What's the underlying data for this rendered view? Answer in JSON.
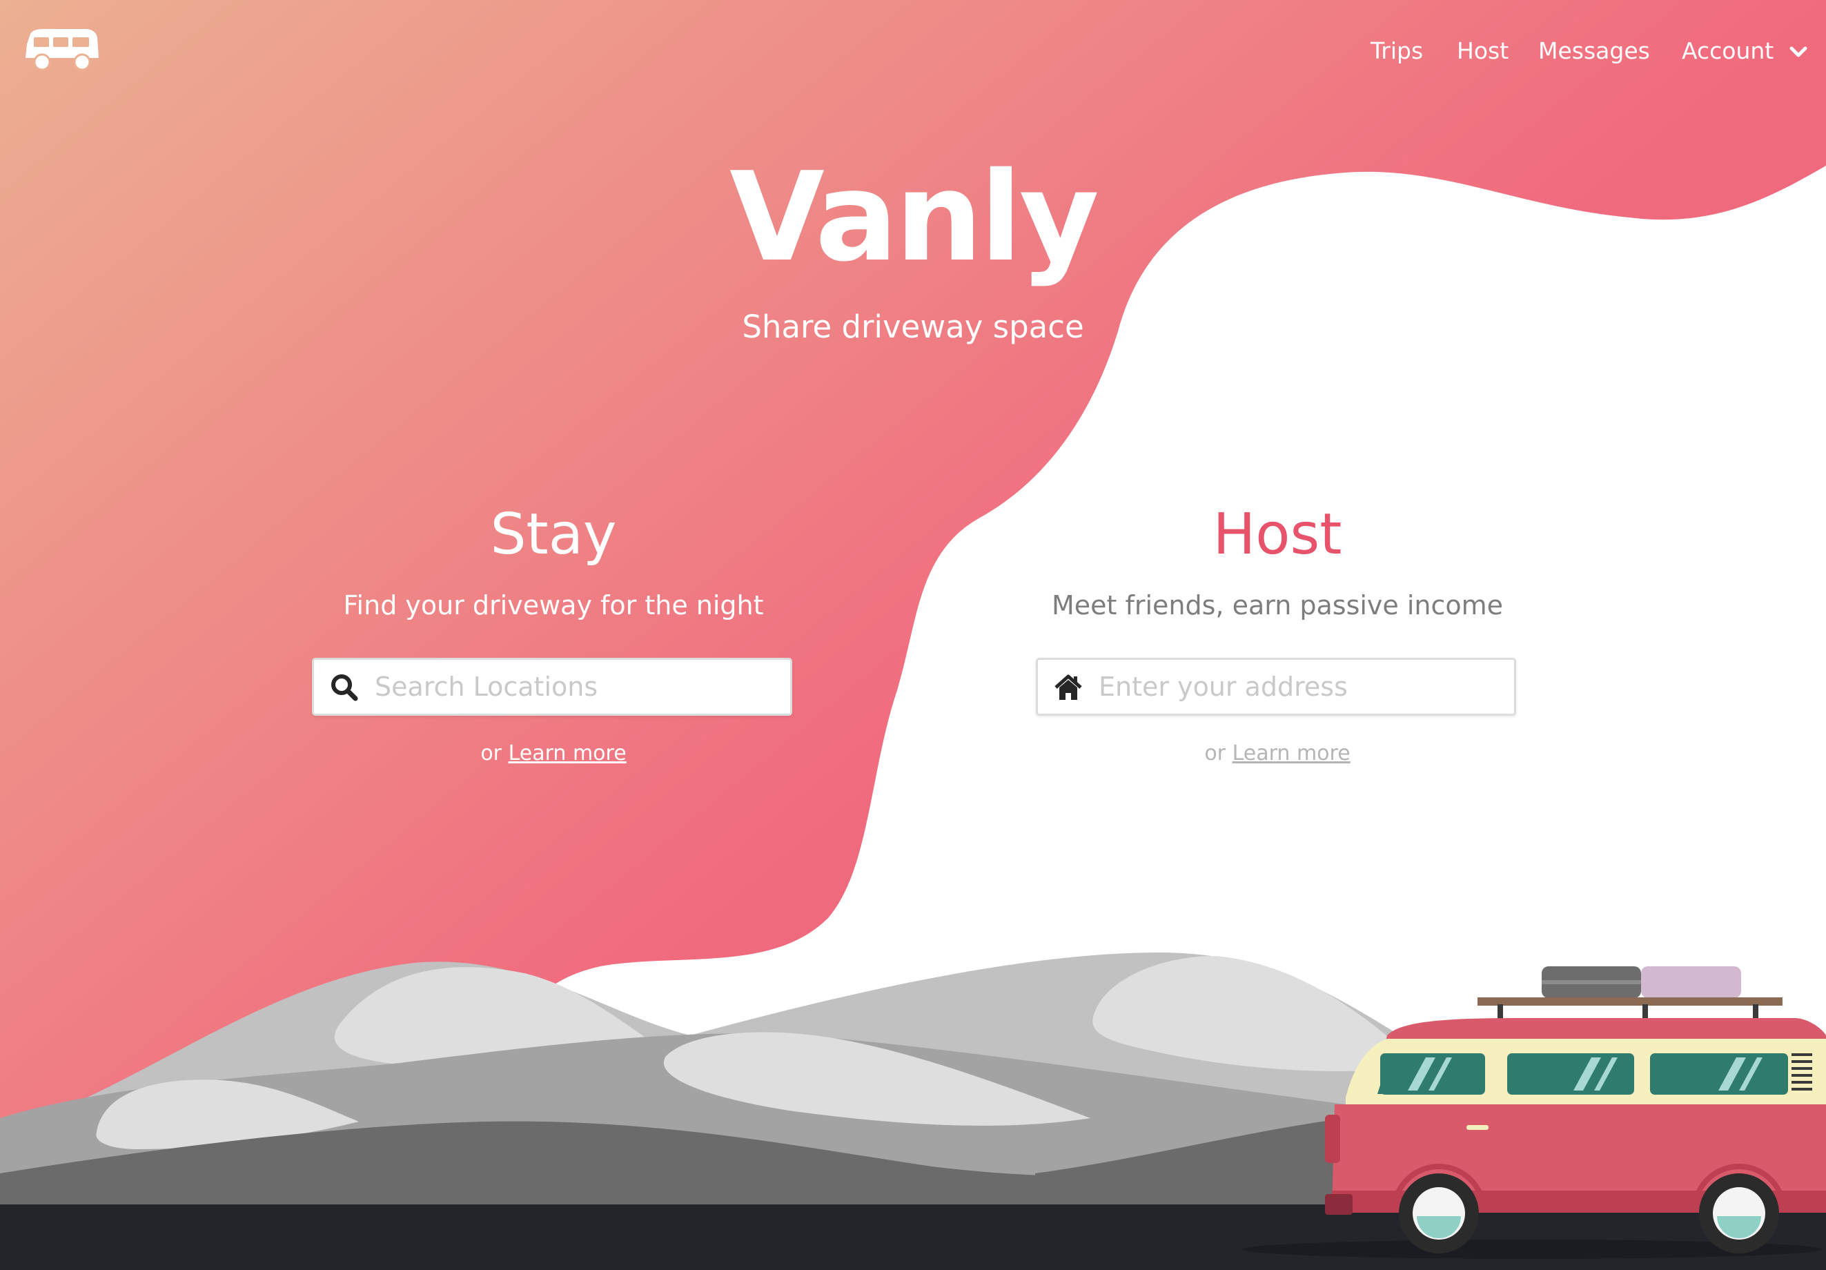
{
  "nav": {
    "logo_icon": "van-icon",
    "items": [
      {
        "label": "Trips"
      },
      {
        "label": "Host"
      },
      {
        "label": "Messages"
      },
      {
        "label": "Account",
        "icon": "chevron-down-icon"
      }
    ]
  },
  "hero": {
    "title": "Vanly",
    "tagline": "Share driveway space"
  },
  "stay": {
    "title": "Stay",
    "subtitle": "Find your driveway for the night",
    "search_placeholder": "Search Locations",
    "search_icon": "search-icon",
    "learn_prefix": "or",
    "learn_link": "Learn more"
  },
  "host": {
    "title": "Host",
    "subtitle": "Meet friends, earn passive income",
    "address_placeholder": "Enter your address",
    "address_icon": "home-icon",
    "learn_prefix": "or",
    "learn_link": "Learn more"
  },
  "colors": {
    "gradient_start": "#ecb092",
    "gradient_end": "#f06a7e",
    "host_accent": "#e6536a",
    "van_body": "#d85a6b",
    "road": "#24252b"
  },
  "illustration": {
    "mountains_icon": "mountains-illustration",
    "van_icon": "van-illustration"
  }
}
